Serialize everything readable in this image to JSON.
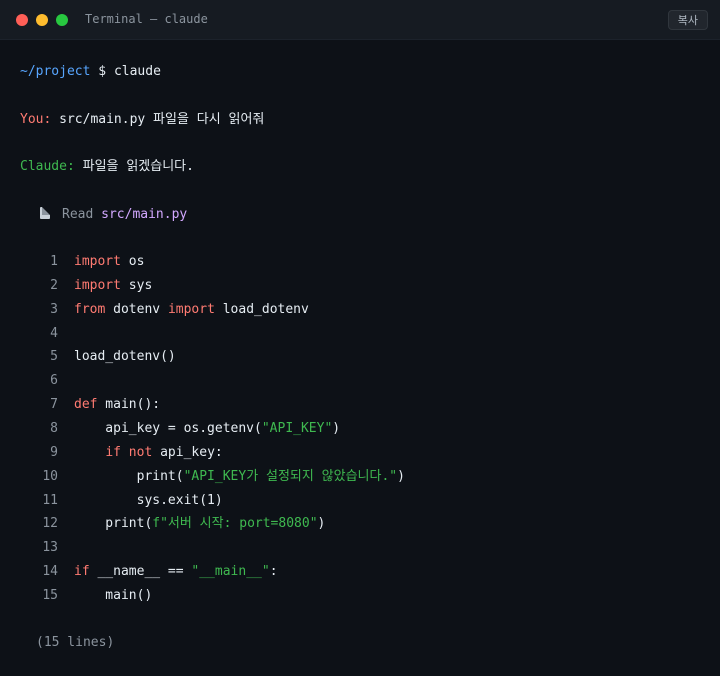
{
  "window": {
    "title": "Terminal — claude",
    "copy_label": "복사"
  },
  "prompt": {
    "path": "~/project",
    "symbol": "$",
    "command": "claude"
  },
  "user": {
    "label": "You:",
    "message": "src/main.py 파일을 다시 읽어줘"
  },
  "assistant": {
    "label": "Claude:",
    "message": "파일을 읽겠습니다."
  },
  "tool": {
    "icon": "file-icon",
    "verb": "Read",
    "file": "src/main.py"
  },
  "code": {
    "lines": [
      {
        "n": "1",
        "parts": [
          {
            "t": "import",
            "c": "kw"
          },
          {
            "t": " os",
            "c": "plain"
          }
        ]
      },
      {
        "n": "2",
        "parts": [
          {
            "t": "import",
            "c": "kw"
          },
          {
            "t": " sys",
            "c": "plain"
          }
        ]
      },
      {
        "n": "3",
        "parts": [
          {
            "t": "from",
            "c": "kw"
          },
          {
            "t": " dotenv ",
            "c": "plain"
          },
          {
            "t": "import",
            "c": "kw"
          },
          {
            "t": " load_dotenv",
            "c": "plain"
          }
        ]
      },
      {
        "n": "4",
        "parts": []
      },
      {
        "n": "5",
        "parts": [
          {
            "t": "load_dotenv()",
            "c": "plain"
          }
        ]
      },
      {
        "n": "6",
        "parts": []
      },
      {
        "n": "7",
        "parts": [
          {
            "t": "def",
            "c": "kw"
          },
          {
            "t": " main():",
            "c": "plain"
          }
        ]
      },
      {
        "n": "8",
        "parts": [
          {
            "t": "    api_key = os.getenv(",
            "c": "plain"
          },
          {
            "t": "\"API_KEY\"",
            "c": "str"
          },
          {
            "t": ")",
            "c": "plain"
          }
        ]
      },
      {
        "n": "9",
        "parts": [
          {
            "t": "    ",
            "c": "plain"
          },
          {
            "t": "if",
            "c": "kw"
          },
          {
            "t": " ",
            "c": "plain"
          },
          {
            "t": "not",
            "c": "kw"
          },
          {
            "t": " api_key:",
            "c": "plain"
          }
        ]
      },
      {
        "n": "10",
        "parts": [
          {
            "t": "        print(",
            "c": "plain"
          },
          {
            "t": "\"API_KEY가 설정되지 않았습니다.\"",
            "c": "str"
          },
          {
            "t": ")",
            "c": "plain"
          }
        ]
      },
      {
        "n": "11",
        "parts": [
          {
            "t": "        sys.exit(1)",
            "c": "plain"
          }
        ]
      },
      {
        "n": "12",
        "parts": [
          {
            "t": "    print(",
            "c": "plain"
          },
          {
            "t": "f\"서버 시작: port=8080\"",
            "c": "str"
          },
          {
            "t": ")",
            "c": "plain"
          }
        ]
      },
      {
        "n": "13",
        "parts": []
      },
      {
        "n": "14",
        "parts": [
          {
            "t": "if",
            "c": "kw"
          },
          {
            "t": " __name__ == ",
            "c": "plain"
          },
          {
            "t": "\"__main__\"",
            "c": "str"
          },
          {
            "t": ":",
            "c": "plain"
          }
        ]
      },
      {
        "n": "15",
        "parts": [
          {
            "t": "    main()",
            "c": "plain"
          }
        ]
      }
    ]
  },
  "footer": "(15 lines)"
}
